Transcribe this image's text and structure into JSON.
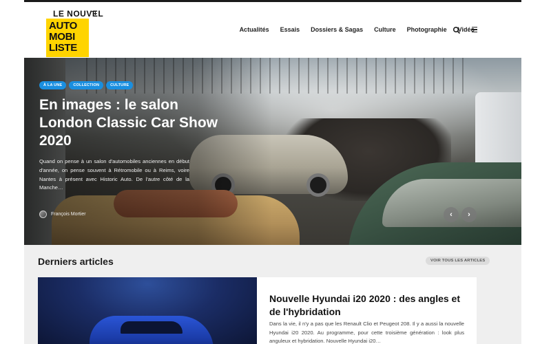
{
  "logo": {
    "top_text": "LE NOUVEL",
    "lines": [
      "AUTO",
      "MOBI",
      "LISTE"
    ]
  },
  "nav": {
    "items": [
      {
        "label": "Actualités"
      },
      {
        "label": "Essais"
      },
      {
        "label": "Dossiers & Sagas"
      },
      {
        "label": "Culture"
      },
      {
        "label": "Photographie"
      },
      {
        "label": "Vidéo"
      }
    ],
    "search_icon": "search-icon",
    "menu_icon": "hamburger-menu-icon"
  },
  "hero": {
    "tags": [
      "À LA UNE",
      "COLLECTION",
      "CULTURE"
    ],
    "title": "En images : le salon London Classic Car Show 2020",
    "excerpt": "Quand on pense à un salon d'automobiles anciennes en début d'année, on pense souvent à Rétromobile ou à Reims, voire Nantes à présent avec Historic Auto. De l'autre côté de la Manche…",
    "author": "François Mortier",
    "prev_icon": "chevron-left-icon",
    "next_icon": "chevron-right-icon"
  },
  "latest": {
    "title": "Derniers articles",
    "see_all": "VOIR TOUS LES ARTICLES",
    "article": {
      "title": "Nouvelle Hyundai i20 2020 : des angles et de l'hybridation",
      "excerpt": "Dans la vie, il n'y a pas que les Renault Clio et Peugeot 208. Il y a aussi la nouvelle Hyundai i20 2020. Au programme, pour cette troisième génération : look plus anguleux et hybridation. Nouvelle Hyundai i20…"
    }
  },
  "colors": {
    "accent_blue": "#1a8fe0",
    "logo_yellow": "#ffd400"
  }
}
